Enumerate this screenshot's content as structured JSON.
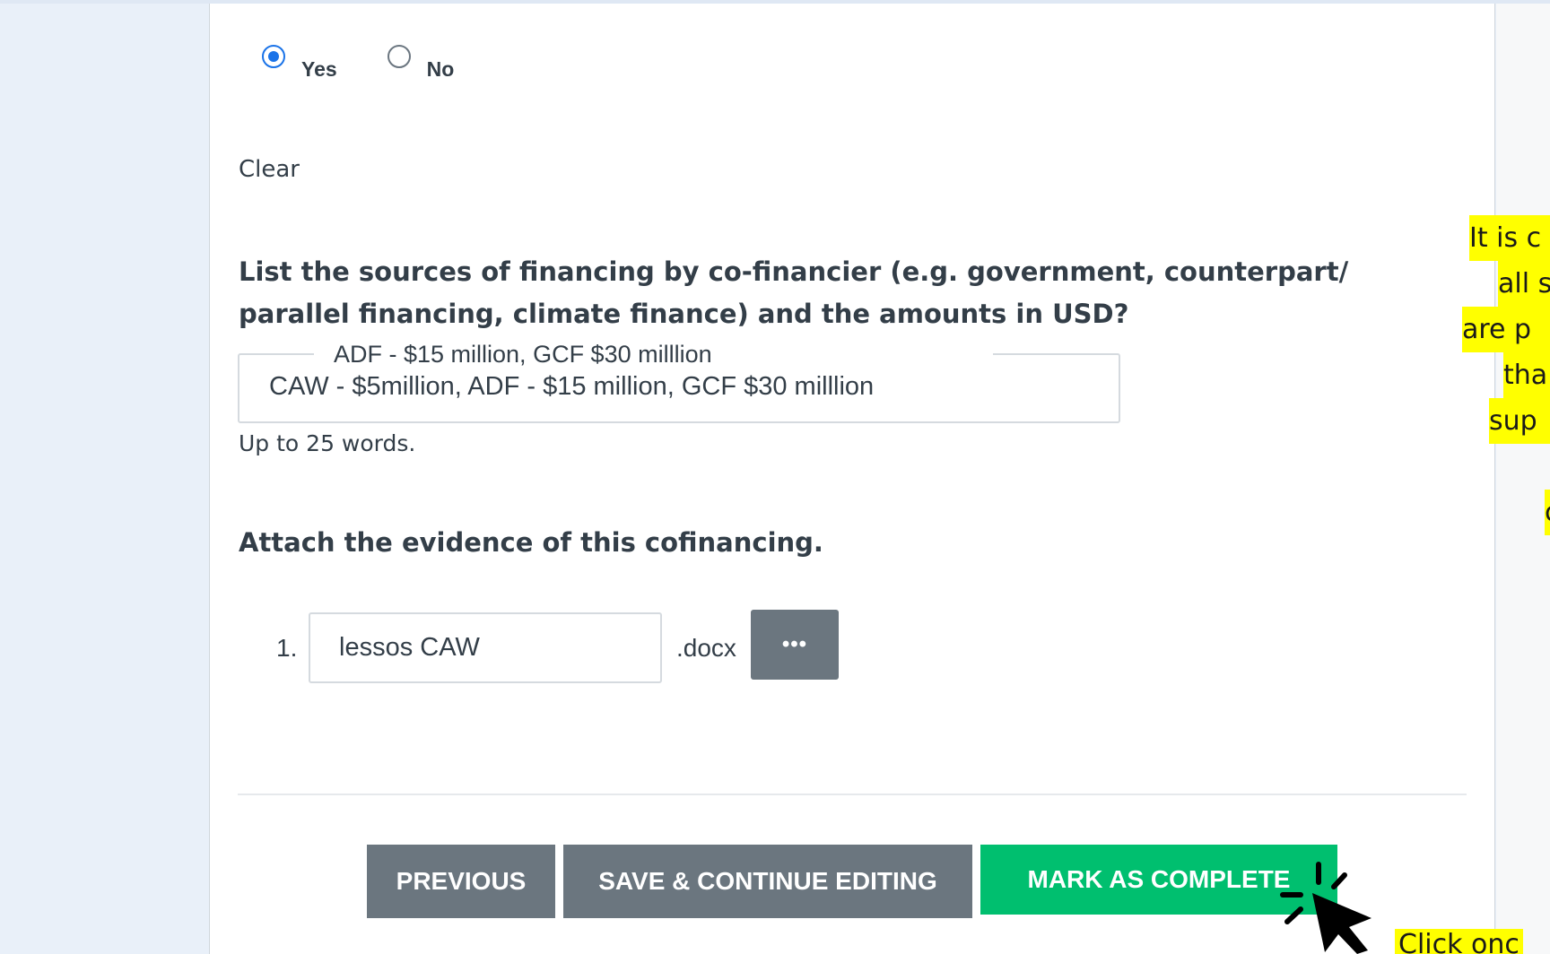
{
  "radio": {
    "options": [
      {
        "label": "Yes",
        "checked": true
      },
      {
        "label": "No",
        "checked": false
      }
    ],
    "clear_label": "Clear"
  },
  "question": {
    "text": "List the sources of financing by co-financier (e.g. government, counterpart/ parallel financing, climate finance) and the amounts in USD?",
    "answer_value": "CAW - $5million, ADF - $15 million, GCF $30 milllion",
    "answer_overlay": "ADF - $15 million, GCF $30 milllion",
    "help_text": "Up to 25 words."
  },
  "attachment": {
    "heading": "Attach the evidence of this cofinancing.",
    "files": [
      {
        "index": "1.",
        "name": "lessos CAW",
        "extension": ".docx",
        "menu_glyph": "•••"
      }
    ]
  },
  "actions": {
    "previous": "PREVIOUS",
    "save": "SAVE & CONTINUE EDITING",
    "complete": "MARK AS COMPLETE"
  },
  "annotations": {
    "side_note_lines": [
      "It is c",
      "all s",
      "are p",
      "tha",
      "sup",
      "",
      "c"
    ],
    "click_note": "Click onc"
  },
  "colors": {
    "accent": "#1a73e8",
    "complete_button": "#00bf6f",
    "grey_button": "#6b767f",
    "highlight": "#ffff00"
  }
}
